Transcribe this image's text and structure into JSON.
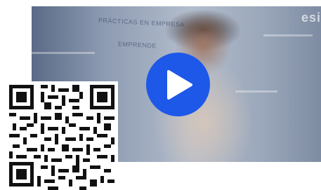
{
  "video": {
    "wall_text_line1": "PRÁCTICAS EN EMPRESA",
    "wall_text_line2": "EMPRENDE",
    "brand_mark": "esi",
    "play_icon": "play-icon",
    "colors": {
      "play_button": "#1d58e8",
      "play_glyph": "#ffffff"
    }
  },
  "qr": {
    "icon": "qr-code-icon",
    "color": "#111111"
  }
}
